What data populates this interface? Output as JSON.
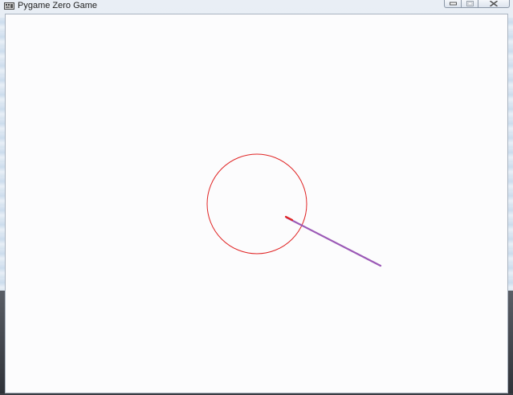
{
  "window": {
    "title": "Pygame Zero Game",
    "icon": "pygame-icon",
    "controls": [
      "minimize-icon",
      "maximize-icon",
      "close-icon"
    ]
  },
  "scene": {
    "background_color": "#fcfcfd",
    "circle": {
      "stroke_color": "#e02424"
    },
    "line": {
      "stroke_color": "#9b59b6",
      "tip_color": "#e02424"
    }
  }
}
